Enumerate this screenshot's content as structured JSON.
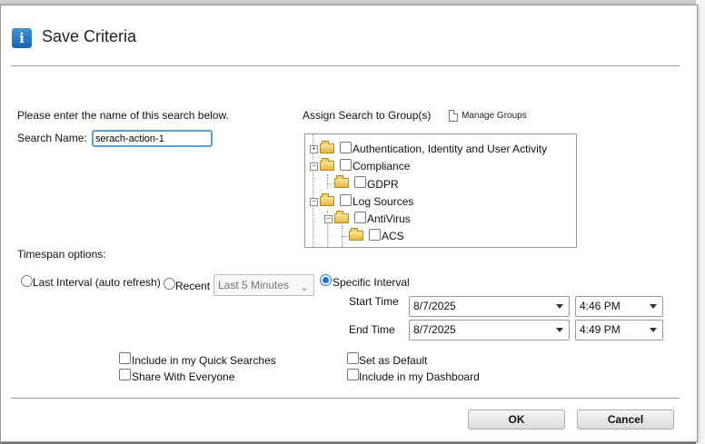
{
  "dialog": {
    "title": "Save Criteria",
    "info_icon": "info-icon",
    "name_prompt": "Please enter the name of this search below.",
    "search_name_label": "Search Name:",
    "search_name_value": "serach-action-1",
    "assign_label": "Assign Search to Group(s)",
    "manage_groups_label": "Manage Groups",
    "tree_nodes": [
      {
        "label": "Authentication, Identity and User Activity",
        "expander": "+"
      },
      {
        "label": "Compliance",
        "expander": "−"
      },
      {
        "label": "GDPR",
        "expander": ""
      },
      {
        "label": "Log Sources",
        "expander": "−"
      },
      {
        "label": "AntiVirus",
        "expander": "−"
      },
      {
        "label": "ACS",
        "expander": ""
      }
    ],
    "timespan_label": "Timespan options:",
    "radio_last_interval": "Last Interval (auto refresh)",
    "radio_recent": "Recent",
    "recent_select_value": "Last 5 Minutes",
    "radio_specific": "Specific Interval",
    "start_time_label": "Start Time",
    "start_date": "8/7/2025",
    "start_time": "4:46 PM",
    "end_time_label": "End Time",
    "end_date": "8/7/2025",
    "end_time": "4:49 PM",
    "cb_quick_searches": "Include in my Quick Searches",
    "cb_share": "Share With Everyone",
    "cb_default": "Set as Default",
    "cb_dashboard": "Include in my Dashboard",
    "ok_label": "OK",
    "cancel_label": "Cancel"
  },
  "colors": {
    "accent": "#1a73e8",
    "input_focus": "#5b9ddc"
  }
}
